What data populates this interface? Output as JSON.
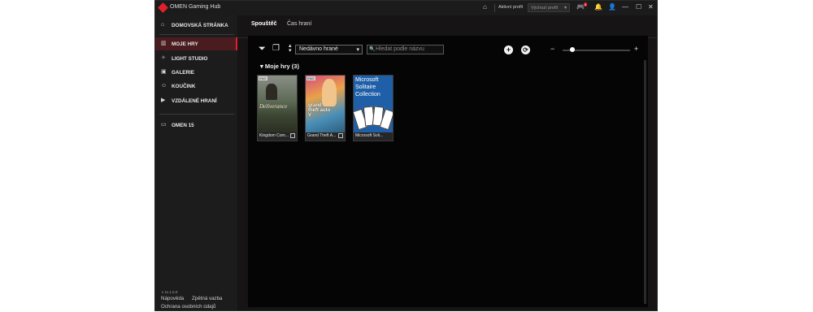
{
  "app": {
    "title": "OMEN Gaming Hub"
  },
  "titlebar": {
    "active_profile_label": "Aktivní profil",
    "profile_value": "Výchozí profil",
    "notification_count": "4",
    "brand_color": "#e0202a"
  },
  "sidebar": {
    "items": [
      {
        "label": "DOMOVSKÁ STRÁNKA",
        "icon": "home-icon"
      },
      {
        "label": "MOJE HRY",
        "icon": "library-icon"
      },
      {
        "label": "LIGHT STUDIO",
        "icon": "sparkle-icon"
      },
      {
        "label": "GALERIE",
        "icon": "gallery-icon"
      },
      {
        "label": "KOUČINK",
        "icon": "coaching-icon"
      },
      {
        "label": "VZDÁLENÉ HRANÍ",
        "icon": "remote-play-icon"
      }
    ],
    "device": {
      "label": "OMEN 15",
      "icon": "laptop-icon"
    },
    "version": "v 11.1.5.0",
    "footer": {
      "help": "Nápověda",
      "feedback": "Zpětná vazba",
      "privacy": "Ochrana osobních údajů"
    }
  },
  "tabs": [
    {
      "label": "Spouštěč"
    },
    {
      "label": "Čas hraní"
    }
  ],
  "toolbar": {
    "sort_value": "Nedávno hrané",
    "search_placeholder": "Hledat podle názvu"
  },
  "library": {
    "group_title": "Moje hry (3)",
    "games": [
      {
        "title": "Kingdom Com...",
        "art_text": "Deliverance",
        "tag": "ENG"
      },
      {
        "title": "Grand Theft A...",
        "art_text": "grand theft auto V",
        "tag": "ENG"
      },
      {
        "title": "Microsoft Soli...",
        "art_text": "Microsoft Solitaire Collection"
      }
    ]
  }
}
